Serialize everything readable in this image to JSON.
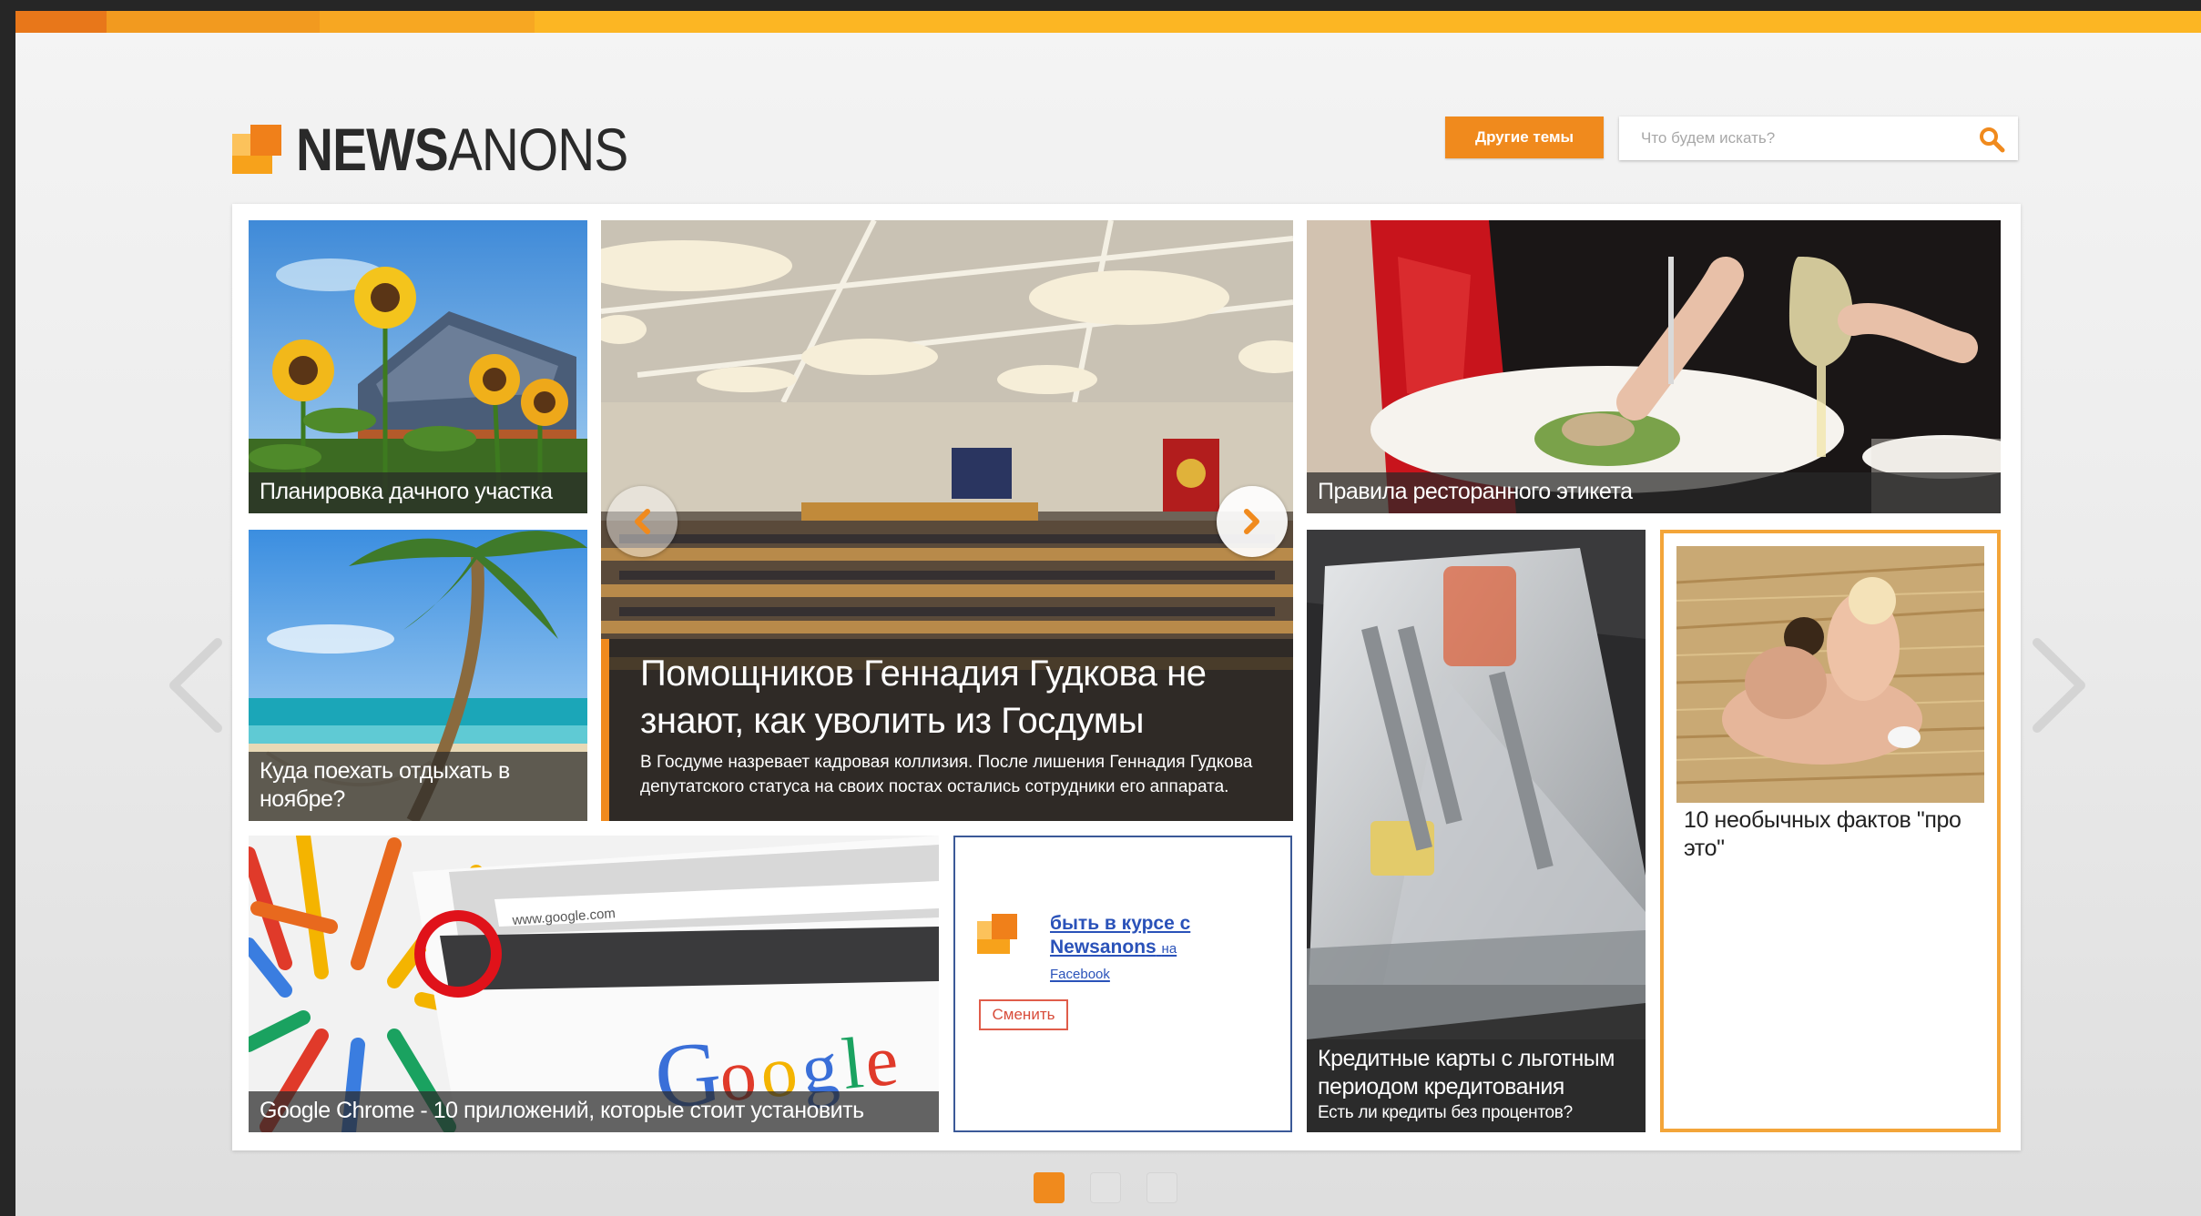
{
  "header": {
    "logo_bold": "NEWS",
    "logo_light": "ANONS",
    "topics_button": "Другие темы",
    "search_placeholder": "Что будем искать?"
  },
  "tiles": {
    "garden": {
      "title": "Планировка дачного участка"
    },
    "beach": {
      "title": "Куда поехать отдыхать в ноябре?"
    },
    "feature": {
      "title": "Помощников Геннадия Гудкова не знают, как уволить из Госдумы",
      "description": "В Госдуме назревает кадровая коллизия. После лишения Геннадия Гудкова депутатского статуса на своих постах остались сотрудники его аппарата."
    },
    "restaurant": {
      "title": "Правила ресторанного этикета"
    },
    "cards": {
      "title": "Кредитные карты с льготным периодом кредитования",
      "subtitle": "Есть ли кредиты без процентов?"
    },
    "facts": {
      "title": "10 необычных фактов \"про это\""
    },
    "chrome": {
      "title": "Google Chrome - 10 приложений, которые стоит установить"
    }
  },
  "facebook_box": {
    "link_text": "быть в курсе с Newsanons",
    "link_suffix": "на",
    "link_network": "Facebook",
    "button": "Сменить"
  },
  "pagination": {
    "pages": 3,
    "active_page": 1
  },
  "colors": {
    "accent": "#f08a1d",
    "highlight_border": "#f3a539",
    "facebook_border": "#3b5998"
  }
}
